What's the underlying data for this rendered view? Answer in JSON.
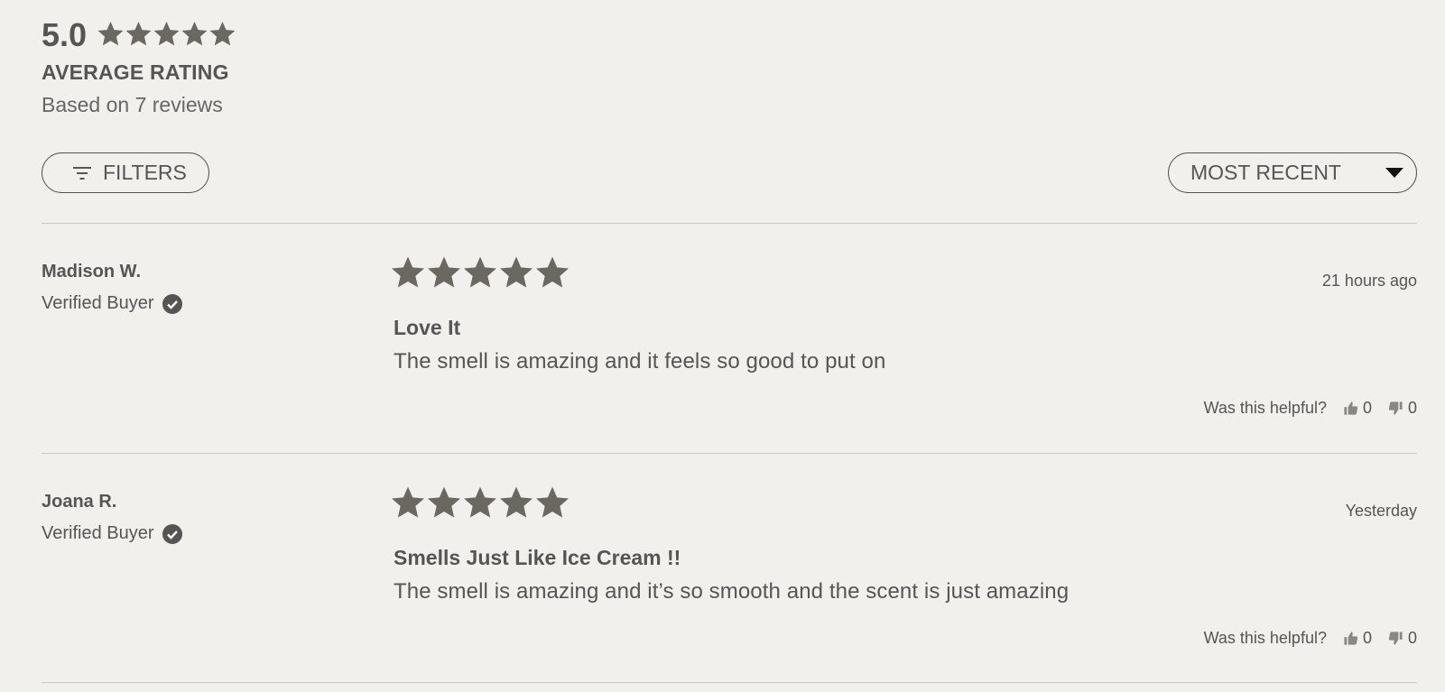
{
  "summary": {
    "average": "5.0",
    "average_label": "AVERAGE RATING",
    "based_on": "Based on 7 reviews",
    "star_rating": 5
  },
  "toolbar": {
    "filters_label": "FILTERS",
    "filters_icon": "filter-icon",
    "sort_label": "MOST RECENT",
    "sort_icon": "chevron-down-icon"
  },
  "reviews": [
    {
      "name": "Madison W.",
      "verified_label": "Verified Buyer",
      "rating": 5,
      "date": "21 hours ago",
      "title": "Love It",
      "body": "The smell is amazing and it feels so good to put on",
      "helpful_question": "Was this helpful?",
      "up_votes": "0",
      "down_votes": "0"
    },
    {
      "name": "Joana R.",
      "verified_label": "Verified Buyer",
      "rating": 5,
      "date": "Yesterday",
      "title": "Smells Just Like Ice Cream !!",
      "body": "The smell is amazing and it’s so smooth and the scent is just amazing",
      "helpful_question": "Was this helpful?",
      "up_votes": "0",
      "down_votes": "0"
    }
  ],
  "colors": {
    "background": "#f1f0ed",
    "text": "#555555",
    "star": "#6a6861",
    "divider": "#c9c8c4"
  }
}
